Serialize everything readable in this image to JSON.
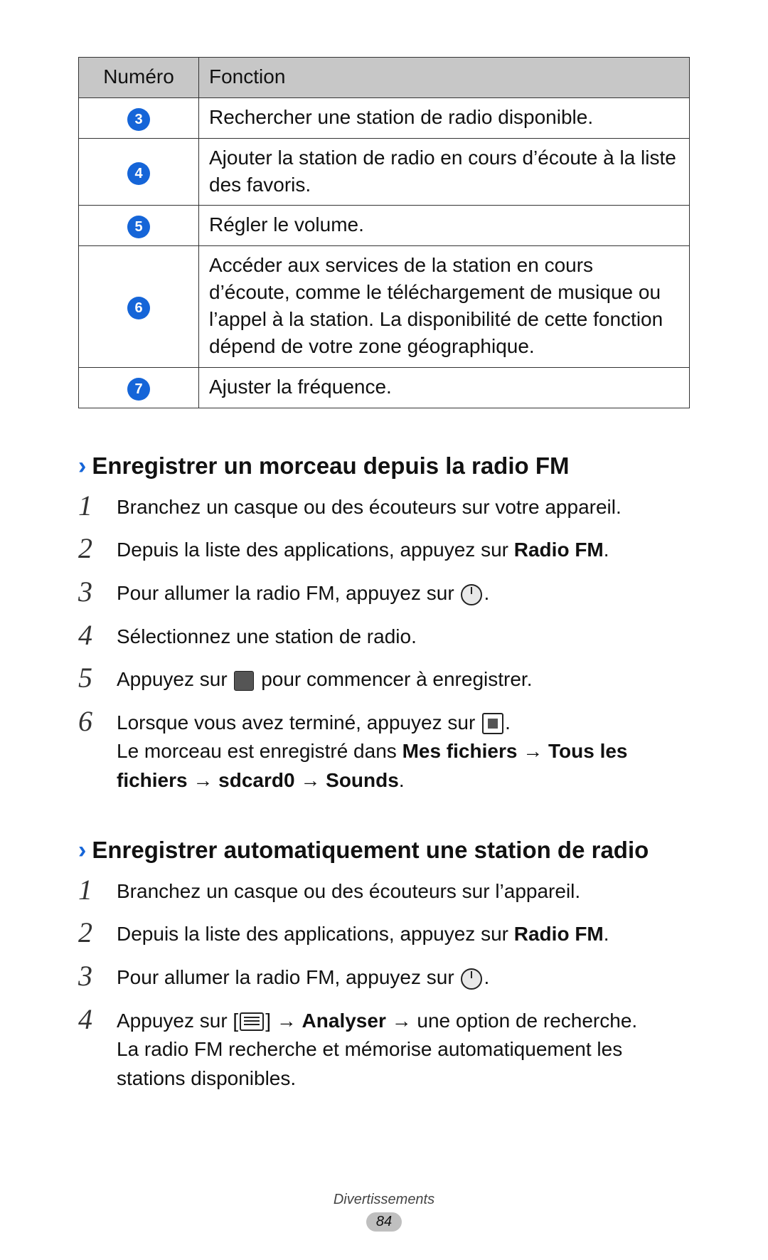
{
  "table": {
    "header_num": "Numéro",
    "header_func": "Fonction",
    "rows": [
      {
        "num": "3",
        "func": "Rechercher une station de radio disponible."
      },
      {
        "num": "4",
        "func": "Ajouter la station de radio en cours d’écoute à la liste des favoris."
      },
      {
        "num": "5",
        "func": "Régler le volume."
      },
      {
        "num": "6",
        "func": "Accéder aux services de la station en cours d’écoute, comme le téléchargement de musique ou l’appel à la station. La disponibilité de cette fonction dépend de votre zone géographique."
      },
      {
        "num": "7",
        "func": "Ajuster la fréquence."
      }
    ]
  },
  "section1": {
    "chevron": "›",
    "title": "Enregistrer un morceau depuis la radio FM",
    "step1_num": "1",
    "step1": "Branchez un casque ou des écouteurs sur votre appareil.",
    "step2_num": "2",
    "step2_a": "Depuis la liste des applications, appuyez sur ",
    "step2_b": "Radio FM",
    "step2_c": ".",
    "step3_num": "3",
    "step3_a": "Pour allumer la radio FM, appuyez sur ",
    "step3_c": ".",
    "step4_num": "4",
    "step4": "Sélectionnez une station de radio.",
    "step5_num": "5",
    "step5_a": "Appuyez sur ",
    "step5_b": " pour commencer à enregistrer.",
    "step6_num": "6",
    "step6_a": "Lorsque vous avez terminé, appuyez sur ",
    "step6_b": ".",
    "step6_line2_a": "Le morceau est enregistré dans ",
    "step6_line2_b": "Mes fichiers",
    "step6_arrow": " → ",
    "step6_line2_c": "Tous les fichiers",
    "step6_line2_d": "sdcard0",
    "step6_line2_e": "Sounds",
    "step6_line2_f": "."
  },
  "section2": {
    "chevron": "›",
    "title": "Enregistrer automatiquement une station de radio",
    "step1_num": "1",
    "step1": "Branchez un casque ou des écouteurs sur l’appareil.",
    "step2_num": "2",
    "step2_a": "Depuis la liste des applications, appuyez sur ",
    "step2_b": "Radio FM",
    "step2_c": ".",
    "step3_num": "3",
    "step3_a": "Pour allumer la radio FM, appuyez sur ",
    "step3_c": ".",
    "step4_num": "4",
    "step4_a": "Appuyez sur [",
    "step4_b": "] → ",
    "step4_c": "Analyser",
    "step4_d": " → une option de recherche.",
    "step4_line2": "La radio FM recherche et mémorise automatiquement les stations disponibles."
  },
  "footer": {
    "section": "Divertissements",
    "page": "84"
  }
}
